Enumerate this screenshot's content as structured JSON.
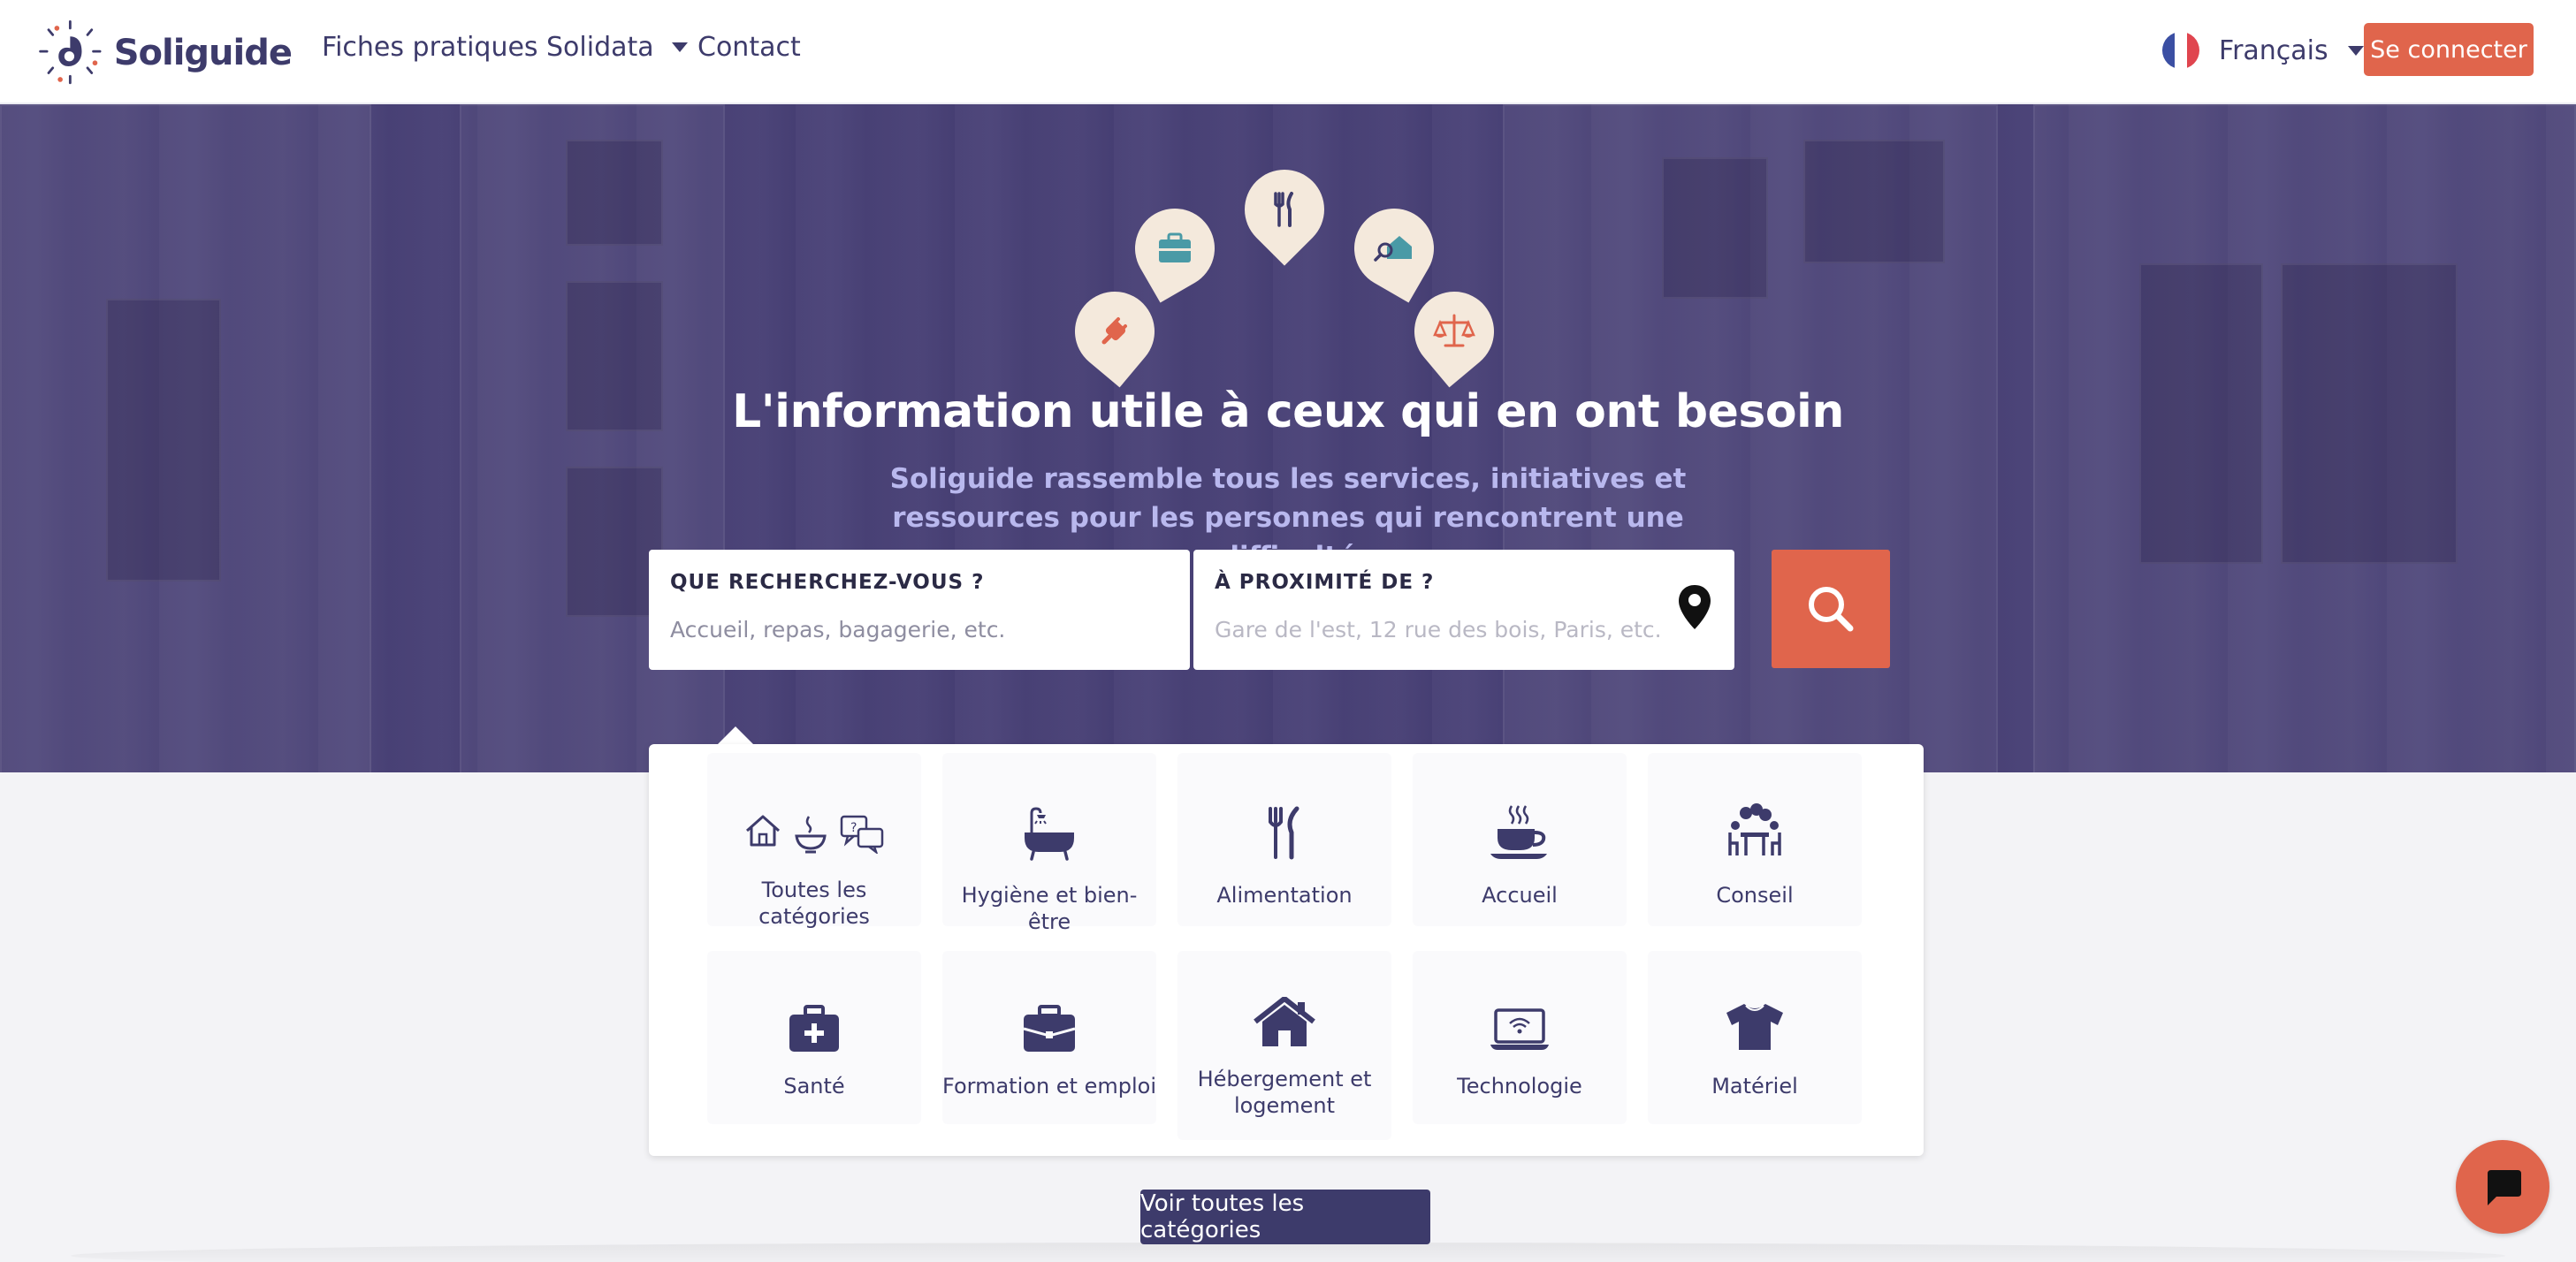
{
  "header": {
    "logo_text": "Soliguide",
    "nav": [
      {
        "label": "Fiches pratiques"
      },
      {
        "label": "Solidata"
      },
      {
        "label": "Contact"
      }
    ],
    "language": "Français",
    "login_label": "Se connecter"
  },
  "hero": {
    "title": "L'information utile à ceux qui en ont besoin",
    "subtitle": "Soliguide rassemble tous les services, initiatives et ressources pour les personnes qui rencontrent une difficulté",
    "pins": [
      "plug-icon",
      "briefcase-icon",
      "fork-knife-icon",
      "house-search-icon",
      "scales-icon"
    ]
  },
  "search": {
    "what_label": "QUE RECHERCHEZ-VOUS ?",
    "what_placeholder": "Accueil, repas, bagagerie, etc.",
    "where_label": "À PROXIMITÉ DE ?",
    "where_placeholder": "Gare de l'est, 12 rue des bois, Paris, etc."
  },
  "categories": [
    {
      "label": "Toutes les catégories",
      "icon": "all-categories-icon"
    },
    {
      "label": "Hygiène et bien-être",
      "icon": "bathtub-icon"
    },
    {
      "label": "Alimentation",
      "icon": "fork-knife-icon"
    },
    {
      "label": "Accueil",
      "icon": "coffee-cup-icon"
    },
    {
      "label": "Conseil",
      "icon": "advice-table-icon"
    },
    {
      "label": "Santé",
      "icon": "medical-kit-icon"
    },
    {
      "label": "Formation et emploi",
      "icon": "briefcase-icon"
    },
    {
      "label": "Hébergement et logement",
      "icon": "house-icon"
    },
    {
      "label": "Technologie",
      "icon": "laptop-wifi-icon"
    },
    {
      "label": "Matériel",
      "icon": "tshirt-icon"
    }
  ],
  "all_categories_button": "Voir toutes les catégories",
  "colors": {
    "brand_navy": "#3d3b6b",
    "accent_orange": "#e0654c",
    "pin_bg": "#f4e9dc",
    "teal": "#4a9aa6"
  }
}
